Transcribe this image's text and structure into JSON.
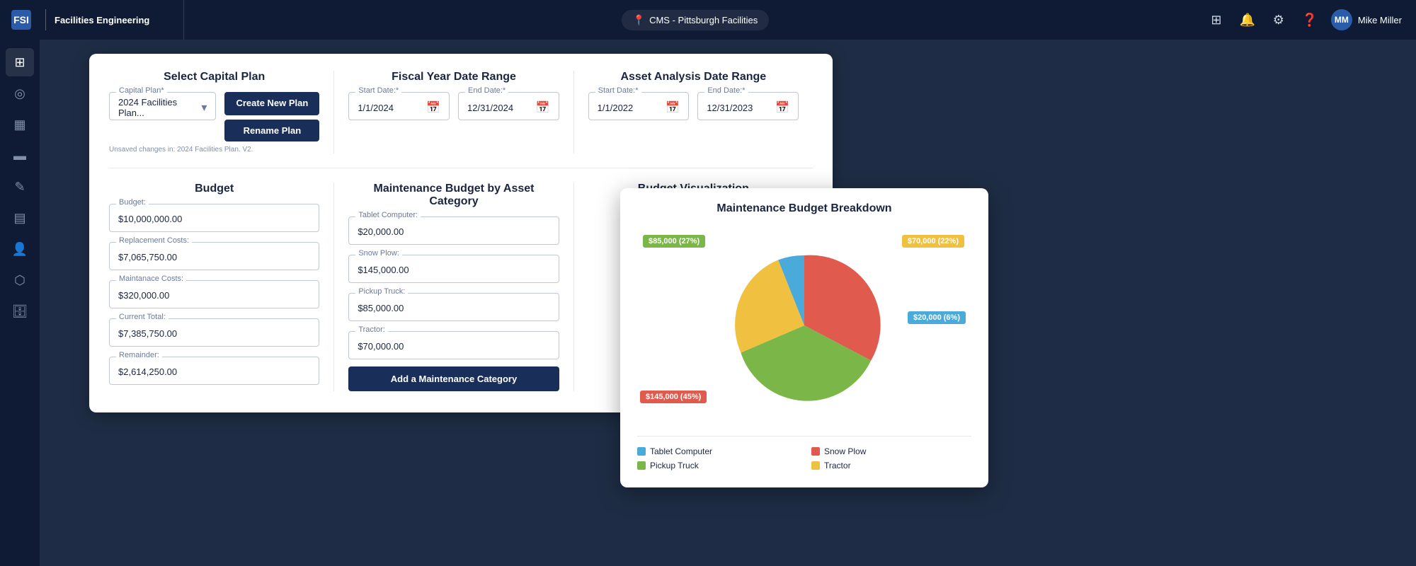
{
  "topbar": {
    "logo_text": "FSI",
    "app_name": "Facilities Engineering",
    "location": "CMS - Pittsburgh Facilities",
    "user_name": "Mike Miller",
    "user_initials": "MM"
  },
  "sidebar": {
    "items": [
      {
        "icon": "⊞",
        "name": "grid"
      },
      {
        "icon": "◎",
        "name": "target"
      },
      {
        "icon": "▦",
        "name": "table"
      },
      {
        "icon": "📅",
        "name": "calendar"
      },
      {
        "icon": "✎",
        "name": "edit"
      },
      {
        "icon": "▤",
        "name": "report"
      },
      {
        "icon": "👤",
        "name": "user"
      },
      {
        "icon": "⬡",
        "name": "hierarchy"
      },
      {
        "icon": "🗄",
        "name": "archive"
      }
    ]
  },
  "capital_plan": {
    "section_title": "Select Capital Plan",
    "plan_label": "Capital Plan*",
    "plan_value": "2024 Facilities Plan...",
    "unsaved_note": "Unsaved changes in: 2024 Facilities Plan. V2.",
    "create_btn": "Create New Plan",
    "rename_btn": "Rename Plan"
  },
  "fiscal_year": {
    "section_title": "Fiscal Year Date Range",
    "start_label": "Start Date:*",
    "start_value": "1/1/2024",
    "end_label": "End Date:*",
    "end_value": "12/31/2024"
  },
  "asset_analysis": {
    "section_title": "Asset Analysis Date Range",
    "start_label": "Start Date:*",
    "start_value": "1/1/2022",
    "end_label": "End Date:*",
    "end_value": "12/31/2023"
  },
  "budget": {
    "section_title": "Budget",
    "fields": [
      {
        "label": "Budget:",
        "value": "$10,000,000.00"
      },
      {
        "label": "Replacement Costs:",
        "value": "$7,065,750.00"
      },
      {
        "label": "Maintanace Costs:",
        "value": "$320,000.00"
      },
      {
        "label": "Current Total:",
        "value": "$7,385,750.00"
      },
      {
        "label": "Remainder:",
        "value": "$2,614,250.00"
      }
    ]
  },
  "maintenance_budget": {
    "section_title": "Maintenance Budget by Asset Category",
    "fields": [
      {
        "label": "Tablet Computer:",
        "value": "$20,000.00"
      },
      {
        "label": "Snow Plow:",
        "value": "$145,000.00"
      },
      {
        "label": "Pickup Truck:",
        "value": "$85,000.00"
      },
      {
        "label": "Tractor:",
        "value": "$70,000.00"
      }
    ],
    "add_btn": "Add a Maintenance Category"
  },
  "budget_viz": {
    "section_title": "Budget Visualization",
    "chart_title": "Maintenance Budget Breakdown",
    "slices": [
      {
        "label": "Snow Plow",
        "value": 145000,
        "pct": 45,
        "color": "#e05a4e",
        "text": "$145,000 (45%)"
      },
      {
        "label": "Pickup Truck",
        "value": 85000,
        "pct": 27,
        "color": "#7ab648",
        "text": "$85,000 (27%)"
      },
      {
        "label": "Tractor",
        "value": 70000,
        "pct": 22,
        "color": "#f0c040",
        "text": "$70,000 (22%)"
      },
      {
        "label": "Tablet Computer",
        "value": 20000,
        "pct": 6,
        "color": "#4aabdb",
        "text": "$20,000 (6%)"
      }
    ],
    "legend": [
      {
        "label": "Tablet Computer",
        "color": "#4aabdb"
      },
      {
        "label": "Snow Plow",
        "color": "#e05a4e"
      },
      {
        "label": "Pickup Truck",
        "color": "#7ab648"
      },
      {
        "label": "Tractor",
        "color": "#f0c040"
      }
    ]
  }
}
